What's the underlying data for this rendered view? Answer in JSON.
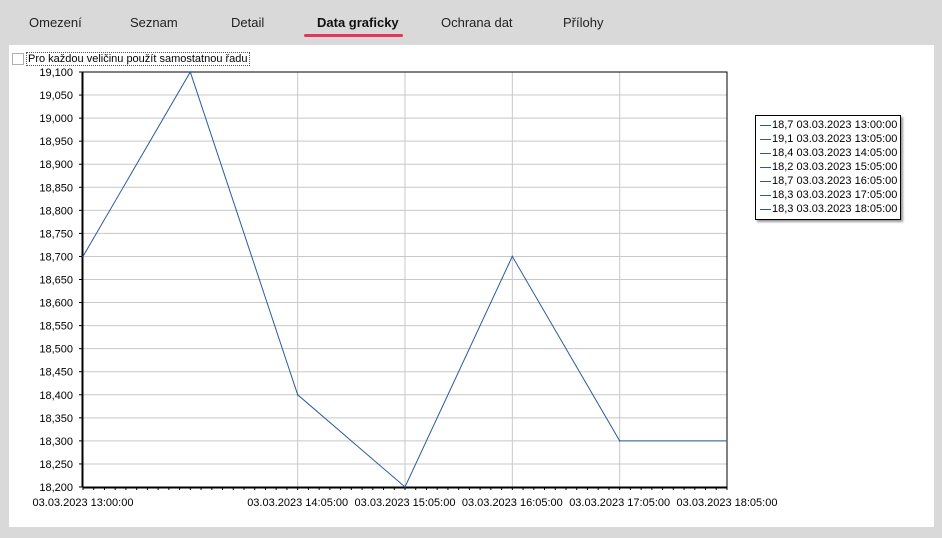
{
  "tabs": [
    {
      "label": "Omezení",
      "active": false
    },
    {
      "label": "Seznam",
      "active": false
    },
    {
      "label": "Detail",
      "active": false
    },
    {
      "label": "Data graficky",
      "active": true
    },
    {
      "label": "Ochrana dat",
      "active": false
    },
    {
      "label": "Přílohy",
      "active": false
    }
  ],
  "option": {
    "label": "Pro každou veličinu použít samostatnou řadu",
    "checked": false
  },
  "colors": {
    "series": "#2a5a9a",
    "accent": "#e8335a",
    "grid": "#c8c8c8"
  },
  "legend_items": [
    "18,7 03.03.2023 13:00:00",
    "19,1 03.03.2023 13:05:00",
    "18,4 03.03.2023 14:05:00",
    "18,2 03.03.2023 15:05:00",
    "18,7 03.03.2023 16:05:00",
    "18,3 03.03.2023 17:05:00",
    "18,3 03.03.2023 18:05:00"
  ],
  "chart_data": {
    "type": "line",
    "title": "",
    "xlabel": "",
    "ylabel": "",
    "x": [
      "03.03.2023 13:00:00",
      "03.03.2023 13:05:00",
      "03.03.2023 14:05:00",
      "03.03.2023 15:05:00",
      "03.03.2023 16:05:00",
      "03.03.2023 17:05:00",
      "03.03.2023 18:05:00"
    ],
    "series": [
      {
        "values": [
          18.7,
          19.1,
          18.4,
          18.2,
          18.7,
          18.3,
          18.3
        ]
      }
    ],
    "ylim": [
      18.2,
      19.1
    ],
    "y_ticks": [
      "18,200",
      "18,250",
      "18,300",
      "18,350",
      "18,400",
      "18,450",
      "18,500",
      "18,550",
      "18,600",
      "18,650",
      "18,700",
      "18,750",
      "18,800",
      "18,850",
      "18,900",
      "18,950",
      "19,000",
      "19,050",
      "19,100"
    ],
    "x_ticks": [
      "03.03.2023 13:00:00",
      "03.03.2023 14:05:00",
      "03.03.2023 15:05:00",
      "03.03.2023 16:05:00",
      "03.03.2023 17:05:00",
      "03.03.2023 18:05:00"
    ],
    "grid": true,
    "legend_position": "right"
  }
}
